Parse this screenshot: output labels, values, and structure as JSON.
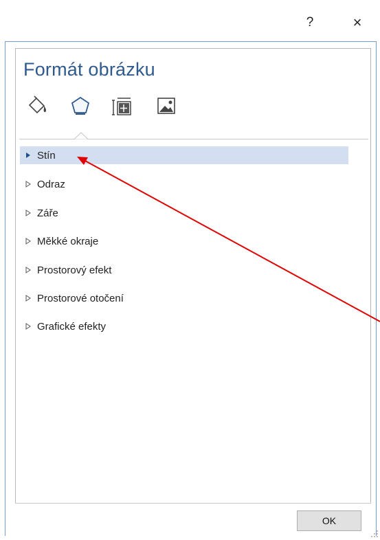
{
  "window": {
    "help_label": "?",
    "close_label": "×"
  },
  "pane": {
    "title": "Formát obrázku",
    "tabs": [
      {
        "icon": "fill-line-icon"
      },
      {
        "icon": "effects-icon",
        "selected": true
      },
      {
        "icon": "size-properties-icon"
      },
      {
        "icon": "picture-icon"
      }
    ]
  },
  "sections": [
    {
      "label": "Stín",
      "expanded_marker": "filled",
      "selected": true
    },
    {
      "label": "Odraz"
    },
    {
      "label": "Záře"
    },
    {
      "label": "Měkké okraje"
    },
    {
      "label": "Prostorový efekt"
    },
    {
      "label": "Prostorové otočení"
    },
    {
      "label": "Grafické efekty"
    }
  ],
  "footer": {
    "ok_label": "OK"
  },
  "colors": {
    "title": "#2e5a8f",
    "selection": "#d3dff0",
    "annotation_arrow": "#e00000"
  }
}
